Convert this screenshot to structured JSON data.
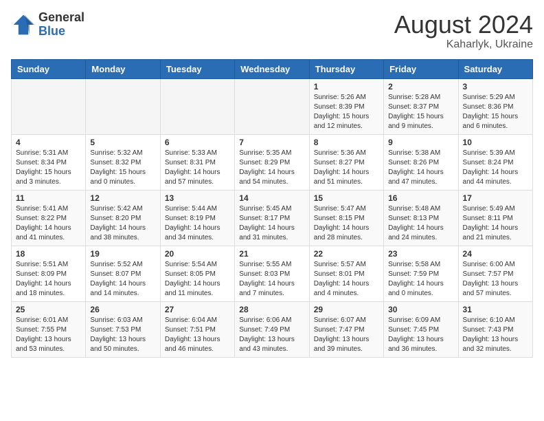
{
  "header": {
    "logo_general": "General",
    "logo_blue": "Blue",
    "month_year": "August 2024",
    "location": "Kaharlyk, Ukraine"
  },
  "calendar": {
    "days_of_week": [
      "Sunday",
      "Monday",
      "Tuesday",
      "Wednesday",
      "Thursday",
      "Friday",
      "Saturday"
    ],
    "weeks": [
      [
        {
          "day": "",
          "info": ""
        },
        {
          "day": "",
          "info": ""
        },
        {
          "day": "",
          "info": ""
        },
        {
          "day": "",
          "info": ""
        },
        {
          "day": "1",
          "info": "Sunrise: 5:26 AM\nSunset: 8:39 PM\nDaylight: 15 hours\nand 12 minutes."
        },
        {
          "day": "2",
          "info": "Sunrise: 5:28 AM\nSunset: 8:37 PM\nDaylight: 15 hours\nand 9 minutes."
        },
        {
          "day": "3",
          "info": "Sunrise: 5:29 AM\nSunset: 8:36 PM\nDaylight: 15 hours\nand 6 minutes."
        }
      ],
      [
        {
          "day": "4",
          "info": "Sunrise: 5:31 AM\nSunset: 8:34 PM\nDaylight: 15 hours\nand 3 minutes."
        },
        {
          "day": "5",
          "info": "Sunrise: 5:32 AM\nSunset: 8:32 PM\nDaylight: 15 hours\nand 0 minutes."
        },
        {
          "day": "6",
          "info": "Sunrise: 5:33 AM\nSunset: 8:31 PM\nDaylight: 14 hours\nand 57 minutes."
        },
        {
          "day": "7",
          "info": "Sunrise: 5:35 AM\nSunset: 8:29 PM\nDaylight: 14 hours\nand 54 minutes."
        },
        {
          "day": "8",
          "info": "Sunrise: 5:36 AM\nSunset: 8:27 PM\nDaylight: 14 hours\nand 51 minutes."
        },
        {
          "day": "9",
          "info": "Sunrise: 5:38 AM\nSunset: 8:26 PM\nDaylight: 14 hours\nand 47 minutes."
        },
        {
          "day": "10",
          "info": "Sunrise: 5:39 AM\nSunset: 8:24 PM\nDaylight: 14 hours\nand 44 minutes."
        }
      ],
      [
        {
          "day": "11",
          "info": "Sunrise: 5:41 AM\nSunset: 8:22 PM\nDaylight: 14 hours\nand 41 minutes."
        },
        {
          "day": "12",
          "info": "Sunrise: 5:42 AM\nSunset: 8:20 PM\nDaylight: 14 hours\nand 38 minutes."
        },
        {
          "day": "13",
          "info": "Sunrise: 5:44 AM\nSunset: 8:19 PM\nDaylight: 14 hours\nand 34 minutes."
        },
        {
          "day": "14",
          "info": "Sunrise: 5:45 AM\nSunset: 8:17 PM\nDaylight: 14 hours\nand 31 minutes."
        },
        {
          "day": "15",
          "info": "Sunrise: 5:47 AM\nSunset: 8:15 PM\nDaylight: 14 hours\nand 28 minutes."
        },
        {
          "day": "16",
          "info": "Sunrise: 5:48 AM\nSunset: 8:13 PM\nDaylight: 14 hours\nand 24 minutes."
        },
        {
          "day": "17",
          "info": "Sunrise: 5:49 AM\nSunset: 8:11 PM\nDaylight: 14 hours\nand 21 minutes."
        }
      ],
      [
        {
          "day": "18",
          "info": "Sunrise: 5:51 AM\nSunset: 8:09 PM\nDaylight: 14 hours\nand 18 minutes."
        },
        {
          "day": "19",
          "info": "Sunrise: 5:52 AM\nSunset: 8:07 PM\nDaylight: 14 hours\nand 14 minutes."
        },
        {
          "day": "20",
          "info": "Sunrise: 5:54 AM\nSunset: 8:05 PM\nDaylight: 14 hours\nand 11 minutes."
        },
        {
          "day": "21",
          "info": "Sunrise: 5:55 AM\nSunset: 8:03 PM\nDaylight: 14 hours\nand 7 minutes."
        },
        {
          "day": "22",
          "info": "Sunrise: 5:57 AM\nSunset: 8:01 PM\nDaylight: 14 hours\nand 4 minutes."
        },
        {
          "day": "23",
          "info": "Sunrise: 5:58 AM\nSunset: 7:59 PM\nDaylight: 14 hours\nand 0 minutes."
        },
        {
          "day": "24",
          "info": "Sunrise: 6:00 AM\nSunset: 7:57 PM\nDaylight: 13 hours\nand 57 minutes."
        }
      ],
      [
        {
          "day": "25",
          "info": "Sunrise: 6:01 AM\nSunset: 7:55 PM\nDaylight: 13 hours\nand 53 minutes."
        },
        {
          "day": "26",
          "info": "Sunrise: 6:03 AM\nSunset: 7:53 PM\nDaylight: 13 hours\nand 50 minutes."
        },
        {
          "day": "27",
          "info": "Sunrise: 6:04 AM\nSunset: 7:51 PM\nDaylight: 13 hours\nand 46 minutes."
        },
        {
          "day": "28",
          "info": "Sunrise: 6:06 AM\nSunset: 7:49 PM\nDaylight: 13 hours\nand 43 minutes."
        },
        {
          "day": "29",
          "info": "Sunrise: 6:07 AM\nSunset: 7:47 PM\nDaylight: 13 hours\nand 39 minutes."
        },
        {
          "day": "30",
          "info": "Sunrise: 6:09 AM\nSunset: 7:45 PM\nDaylight: 13 hours\nand 36 minutes."
        },
        {
          "day": "31",
          "info": "Sunrise: 6:10 AM\nSunset: 7:43 PM\nDaylight: 13 hours\nand 32 minutes."
        }
      ]
    ]
  }
}
